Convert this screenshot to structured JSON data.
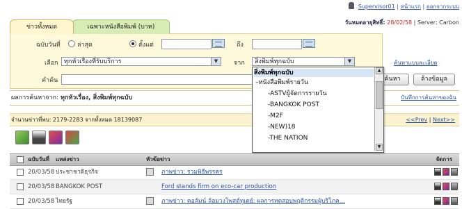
{
  "topbar": {
    "user_link": "Supervisor01",
    "links": [
      "หน้าแรก",
      "ออกจากระบบ"
    ],
    "expiry_label": "วันหมดอายุสิทธิ์:",
    "expiry_date": "28/02/58",
    "server_label": "Server: Carbon"
  },
  "tabs": [
    {
      "label": "ข่าวทั้งหมด"
    },
    {
      "label": "เฉพาะหนังสือพิมพ์ (บาท)"
    }
  ],
  "form": {
    "date_label": "ฉบับวันที่",
    "radio_all": "ล่าสุด",
    "radio_range": "ตั้งแต่",
    "to_label": "ถึง",
    "select_label": "เลือก",
    "select_value": "ทุกหัวเรื่องที่รับบริการ",
    "from_label": "จาก",
    "from_value": "สิ่งพิมพ์ทุกฉบับ",
    "keyword_label": "คำค้น",
    "adv_link": "ค้นหาแบบละเอียด",
    "search_btn": "ค้นหา",
    "reset_btn": "ล้างข้อมูล"
  },
  "dropdown": {
    "items": [
      "สิ่งพิมพ์ทุกฉบับ",
      "หนังสือพิมพ์รายวัน",
      "ASTVผู้จัดการรายวัน",
      "BANGKOK POST",
      "M2F",
      "NEW)18",
      "THE NATION"
    ]
  },
  "result": {
    "label": "ผลการค้นหาจาก:",
    "value": "ทุกหัวเรื่อง, สิ่งพิมพ์ทุกฉบับ",
    "right_link": "บันทึกการค้นหาของฉัน"
  },
  "count": {
    "text": "จำนวนข่าวที่พบ: 2179-2283  จากทั้งหมด 18139087",
    "prev": "<<Prev",
    "next": "Next>>"
  },
  "table": {
    "headers": [
      "ฉบับวันที่",
      "แหล่งข่าว",
      "หัวข้อข่าว",
      "จัดการ"
    ],
    "rows": [
      {
        "date": "20/03/58",
        "source": "ประชาชาติธุรกิจ",
        "title": "ภาพข่าว: รวมพิธีพรรคร"
      },
      {
        "date": "20/03/58",
        "source": "BANGKOK POST",
        "title": "Ford stands firm on eco-car production"
      },
      {
        "date": "20/03/58",
        "source": "ไทยรัฐ",
        "title": "ภาพข่าว: คอลัมน์ ล้อมวงโพสต์ทูเดย์: ผลการทดสอบพฤติกรรมผู้บริโภค..."
      }
    ]
  },
  "colors": {
    "accent": "#2c55a8",
    "date_red": "#cc2222",
    "tab_active": "#fff6cf",
    "tab_inactive": "#d8ecb6"
  }
}
